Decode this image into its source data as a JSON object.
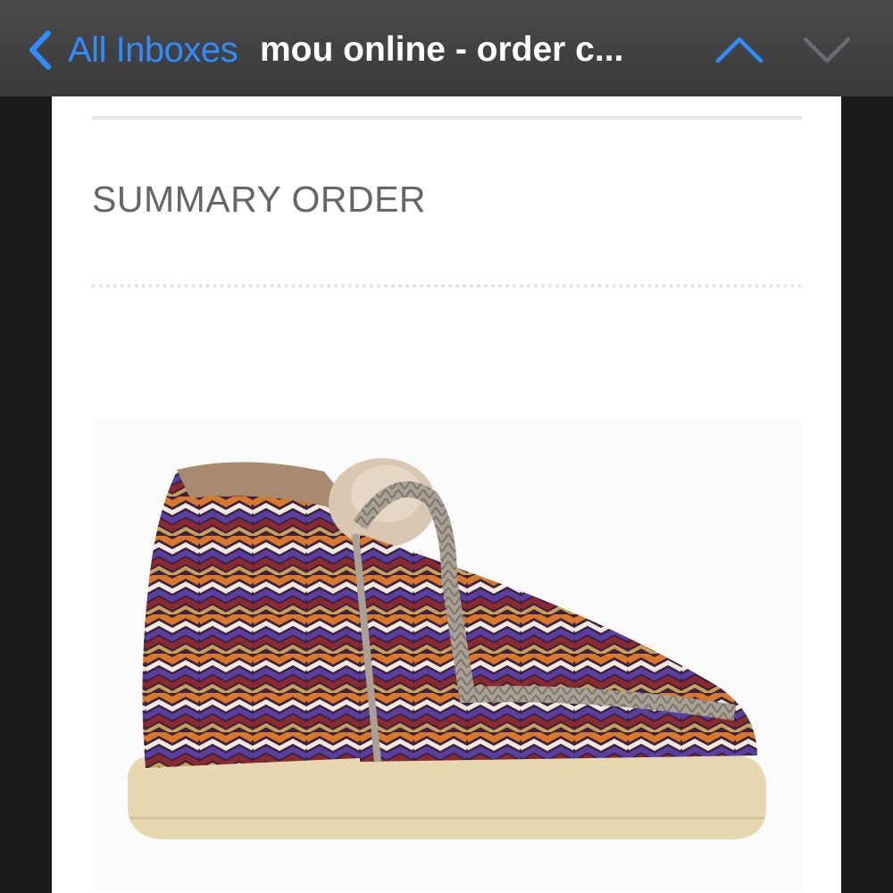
{
  "navbar": {
    "back_label": "All Inboxes",
    "title": "mou online - order c..."
  },
  "colors": {
    "accent": "#2f8cff",
    "navbar_bg": "#3a3a3c",
    "section_title": "#666666"
  },
  "email": {
    "section_title": "SUMMARY ORDER"
  },
  "icons": {
    "back": "chevron-left-icon",
    "previous": "chevron-up-icon",
    "next": "chevron-down-icon"
  }
}
